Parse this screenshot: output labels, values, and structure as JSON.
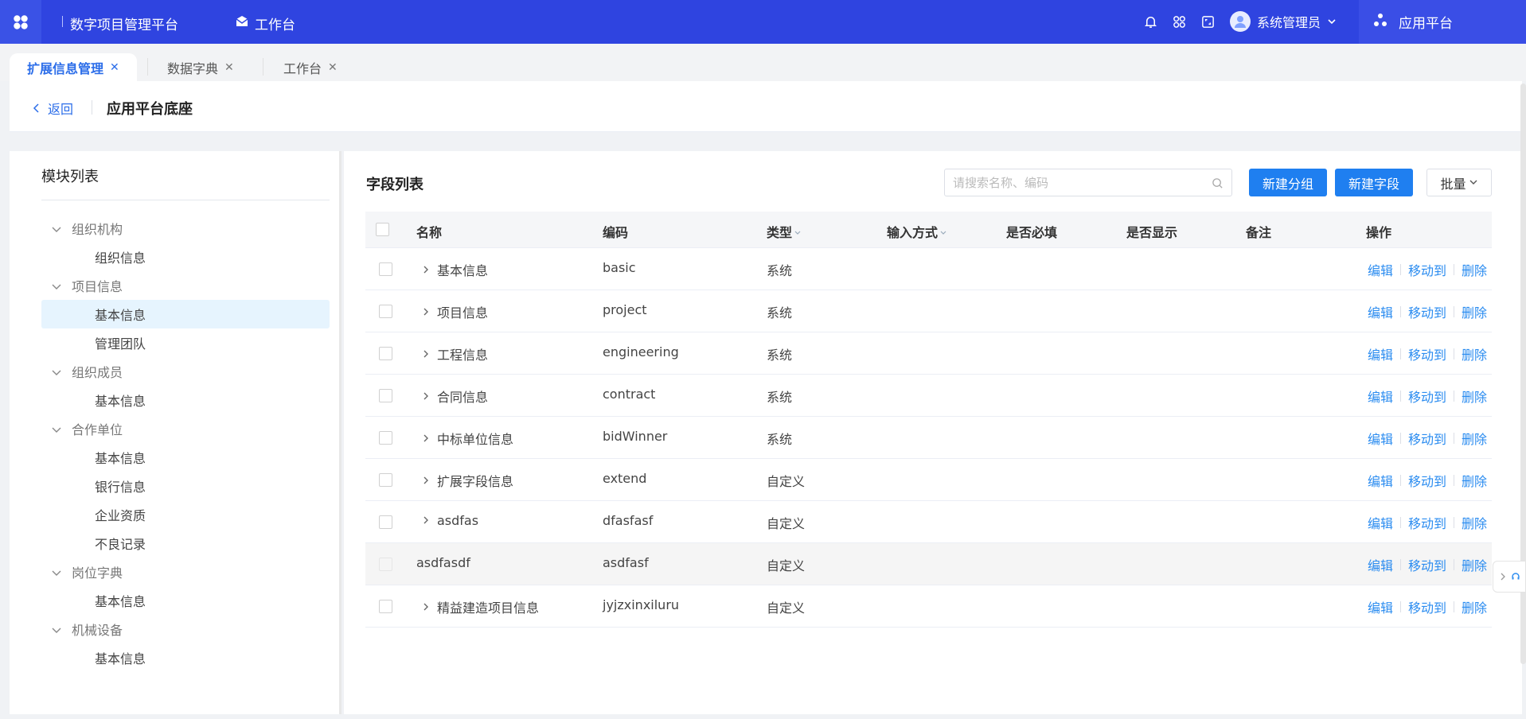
{
  "topbar": {
    "platform_title": "数字项目管理平台",
    "workbench_label": "工作台",
    "user_name": "系统管理员",
    "app_platform_label": "应用平台",
    "accent_color": "#2f44e0"
  },
  "tabs": [
    {
      "label": "扩展信息管理",
      "active": true
    },
    {
      "label": "数据字典",
      "active": false
    },
    {
      "label": "工作台",
      "active": false
    }
  ],
  "header": {
    "back_label": "返回",
    "title": "应用平台底座"
  },
  "module_list": {
    "title": "模块列表",
    "groups": [
      {
        "label": "组织机构",
        "children": [
          "组织信息"
        ]
      },
      {
        "label": "项目信息",
        "children": [
          "基本信息",
          "管理团队"
        ]
      },
      {
        "label": "组织成员",
        "children": [
          "基本信息"
        ]
      },
      {
        "label": "合作单位",
        "children": [
          "基本信息",
          "银行信息",
          "企业资质",
          "不良记录"
        ]
      },
      {
        "label": "岗位字典",
        "children": [
          "基本信息"
        ]
      },
      {
        "label": "机械设备",
        "children": [
          "基本信息"
        ]
      }
    ],
    "selected": "项目信息/基本信息"
  },
  "field_list": {
    "title": "字段列表",
    "search_placeholder": "请搜索名称、编码",
    "new_group_label": "新建分组",
    "new_field_label": "新建字段",
    "batch_label": "批量",
    "columns": [
      "名称",
      "编码",
      "类型",
      "输入方式",
      "是否必填",
      "是否显示",
      "备注",
      "操作"
    ],
    "rows": [
      {
        "name": "基本信息",
        "code": "basic",
        "type": "系统",
        "expandable": true
      },
      {
        "name": "项目信息",
        "code": "project",
        "type": "系统",
        "expandable": true
      },
      {
        "name": "工程信息",
        "code": "engineering",
        "type": "系统",
        "expandable": true
      },
      {
        "name": "合同信息",
        "code": "contract",
        "type": "系统",
        "expandable": true
      },
      {
        "name": "中标单位信息",
        "code": "bidWinner",
        "type": "系统",
        "expandable": true
      },
      {
        "name": "扩展字段信息",
        "code": "extend",
        "type": "自定义",
        "expandable": true
      },
      {
        "name": "asdfas",
        "code": "dfasfasf",
        "type": "自定义",
        "expandable": true
      },
      {
        "name": "asdfasdf",
        "code": "asdfasf",
        "type": "自定义",
        "expandable": false
      },
      {
        "name": "精益建造项目信息",
        "code": "jyjzxinxiluru",
        "type": "自定义",
        "expandable": true
      }
    ],
    "ops": {
      "edit": "编辑",
      "move": "移动到",
      "delete": "删除"
    }
  }
}
